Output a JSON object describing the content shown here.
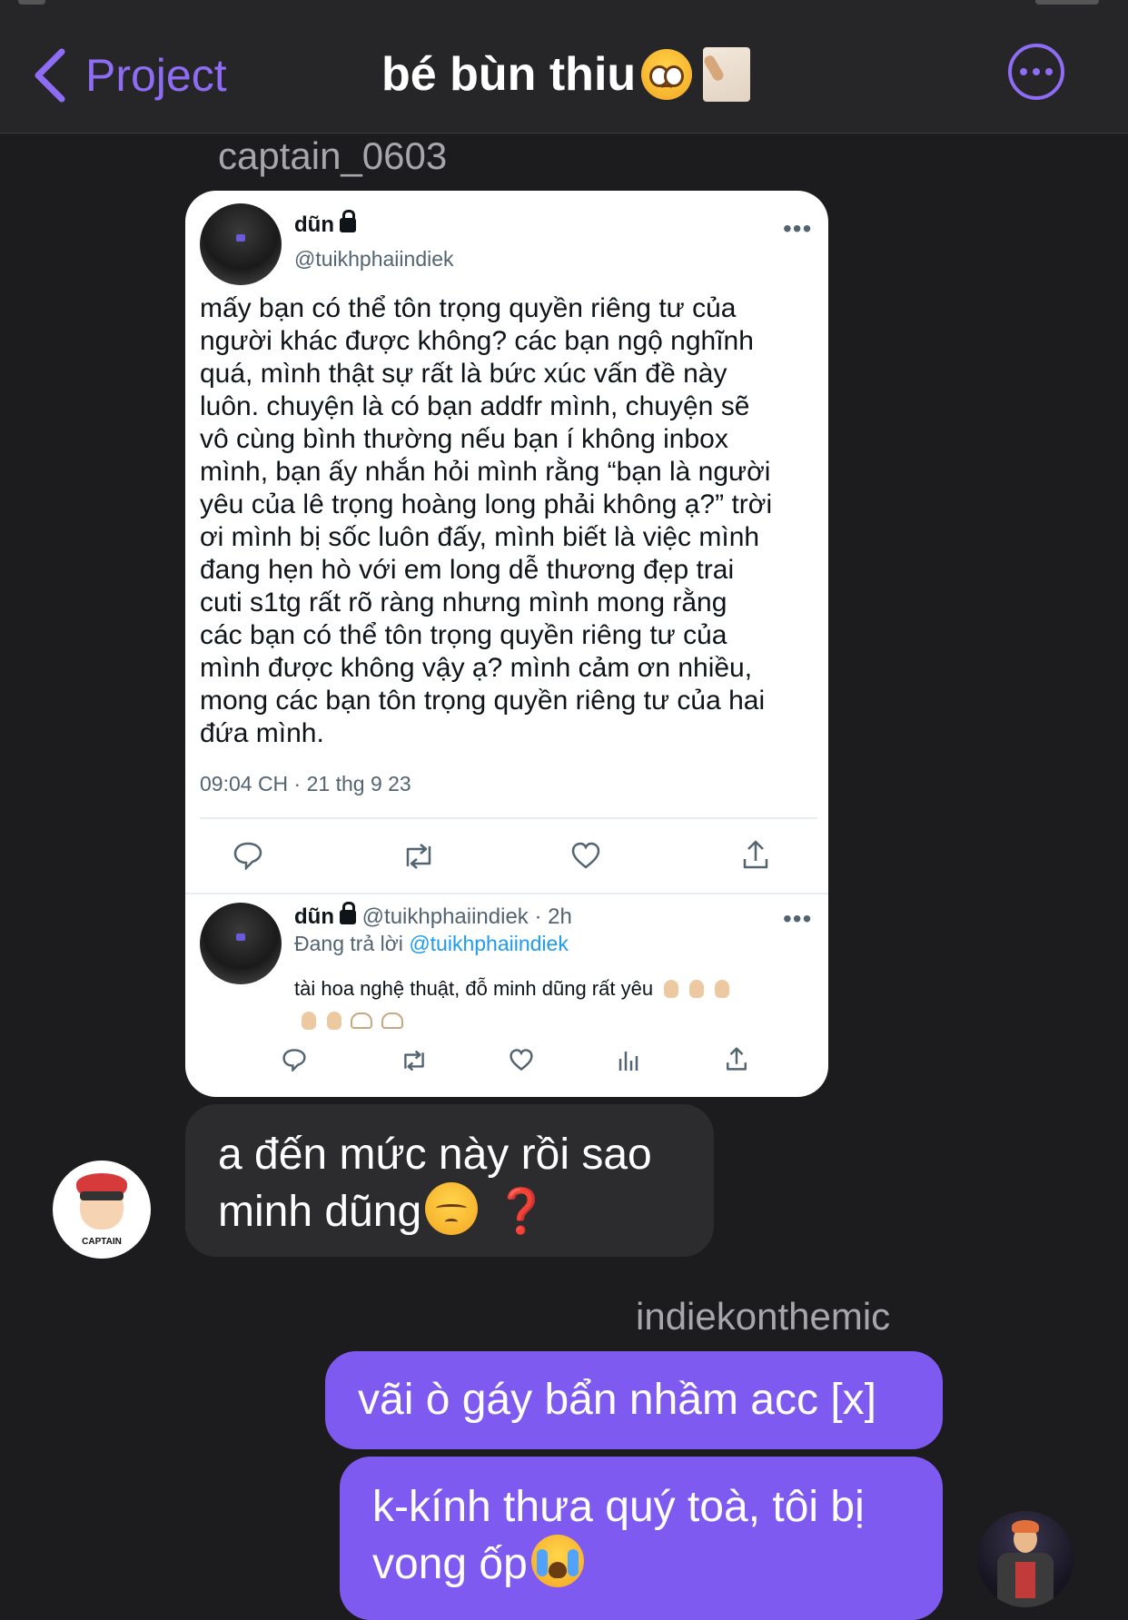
{
  "header": {
    "back_label": "Project",
    "title": "bé bùn thiu"
  },
  "messages": {
    "sender_top": "captain_0603",
    "sender_me": "indiekonthemic",
    "incoming_1_line1": "a đến mức này rồi sao",
    "incoming_1_line2": "minh dũng",
    "incoming_1_mark": "❓",
    "outgoing_1": "vãi ò gáy bẩn nhầm acc [x]",
    "outgoing_2_line1": "k-kính thưa quý toà, tôi bị",
    "outgoing_2_line2": "vong ốp",
    "avatar_label": "CAPTAIN"
  },
  "tweet": {
    "name": "dũn",
    "handle": "@tuikhphaiindiek",
    "body_lines": [
      "mấy bạn có thể tôn trọng quyền riêng tư của",
      "người khác được không? các bạn ngộ nghĩnh",
      "quá, mình thật sự rất là bức xúc vấn đề này",
      "luôn. chuyện là có bạn addfr mình, chuyện sẽ",
      "vô cùng bình thường nếu bạn í không inbox",
      "mình, bạn ấy nhắn hỏi mình rằng “bạn là người",
      "yêu của lê trọng hoàng long phải không ạ?” trời",
      "ơi mình bị sốc luôn đấy, mình biết là việc mình",
      "đang hẹn hò với em long dễ thương đẹp trai",
      "cuti s1tg rất rõ ràng nhưng mình mong rằng",
      "các bạn có thể tôn trọng quyền riêng tư của",
      "mình được không vậy ạ? mình cảm ơn nhiều,",
      "mong các bạn tôn trọng quyền riêng tư của hai",
      "đứa mình."
    ],
    "timestamp": "09:04 CH · 21 thg 9 23",
    "more_label": "•••"
  },
  "reply": {
    "name": "dũn",
    "handle_time": "@tuikhphaiindiek · 2h",
    "replying_prefix": "Đang trả lời",
    "replying_mention": "@tuikhphaiindiek",
    "text": "tài hoa nghệ thuật, đỗ minh dũng rất yêu",
    "more_label": "•••"
  },
  "colors": {
    "accent": "#8e6cf3",
    "outgoing_bubble": "#7f5af0",
    "incoming_bubble": "#2c2c2e",
    "background": "#1c1c1e",
    "link": "#1d9bf0"
  },
  "icons": [
    "chevron-left-icon",
    "more-icon",
    "lock-icon",
    "reply-icon",
    "retweet-icon",
    "like-icon",
    "share-icon",
    "analytics-icon"
  ]
}
